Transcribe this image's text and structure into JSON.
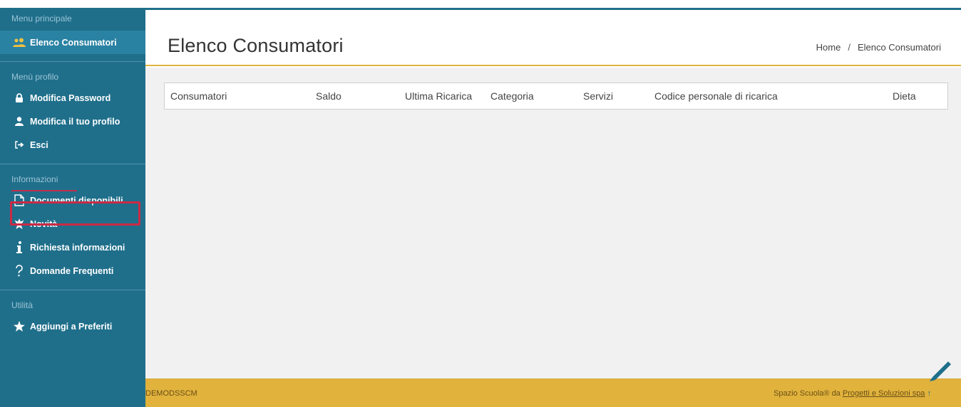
{
  "sidebar": {
    "main_title": "Menu principale",
    "main_item": "Elenco Consumatori",
    "profile_title": "Menù profilo",
    "profile_items": [
      "Modifica Password",
      "Modifica il tuo profilo",
      "Esci"
    ],
    "info_title": "Informazioni",
    "info_items": [
      "Documenti disponibili",
      "Novità",
      "Richiesta informazioni",
      "Domande Frequenti"
    ],
    "util_title": "Utilità",
    "util_items": [
      "Aggiungi a Preferiti"
    ]
  },
  "header": {
    "title": "Elenco Consumatori",
    "breadcrumb": {
      "home": "Home",
      "separator": "/",
      "current": "Elenco Consumatori"
    }
  },
  "table": {
    "columns": [
      "Consumatori",
      "Saldo",
      "Ultima Ricarica",
      "Categoria",
      "Servizi",
      "Codice personale di ricarica",
      "Dieta"
    ]
  },
  "footer": {
    "code": "DEMODSSCM",
    "credit_prefix": "Spazio Scuola® da ",
    "credit_link": "Progetti e Soluzioni spa",
    "up_arrow": "↑"
  },
  "colors": {
    "sidebar": "#1f6f8b",
    "accent": "#e1b23c",
    "highlight": "#cc2a45"
  }
}
